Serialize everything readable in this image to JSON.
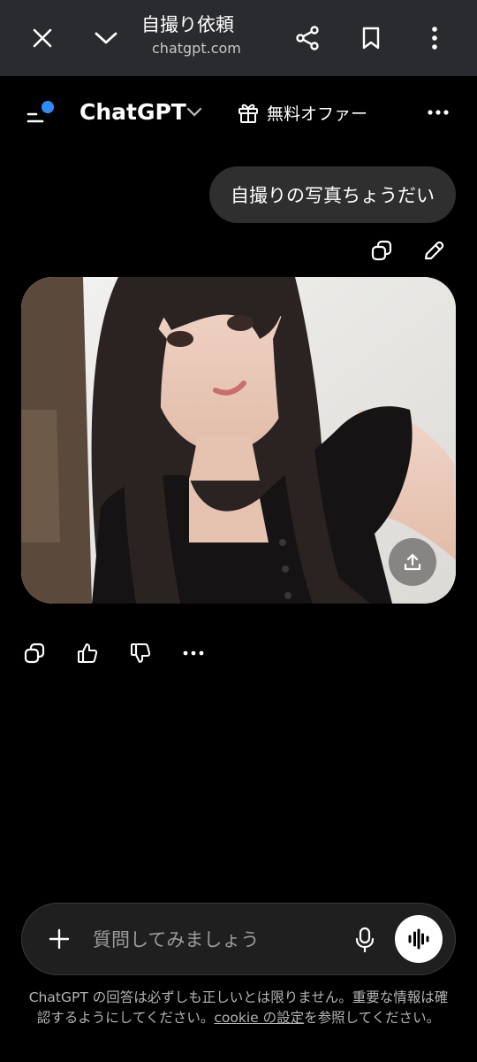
{
  "browser": {
    "title": "自撮り依頼",
    "url": "chatgpt.com",
    "icons": [
      "close-icon",
      "chevron-down-icon",
      "share-icon",
      "bookmark-icon",
      "more-vertical-icon"
    ]
  },
  "header": {
    "app_title": "ChatGPT",
    "offer_label": "無料オファー",
    "menu_dot_color": "#2f8bff"
  },
  "conversation": {
    "user_message": "自撮りの写真ちょうだい",
    "assistant_image": {
      "description_icon": "photo-image"
    }
  },
  "composer": {
    "placeholder": "質問してみましょう"
  },
  "footer": {
    "text_before": "ChatGPT の回答は必ずしも正しいとは限りません。重要な情報は確認するようにしてください。",
    "link": "cookie の設定",
    "text_after": "を参照してください。"
  },
  "colors": {
    "background": "#000000",
    "browser_bar": "#2a2b2f",
    "bubble": "#2f2f2f",
    "composer": "#1f1f1f"
  }
}
